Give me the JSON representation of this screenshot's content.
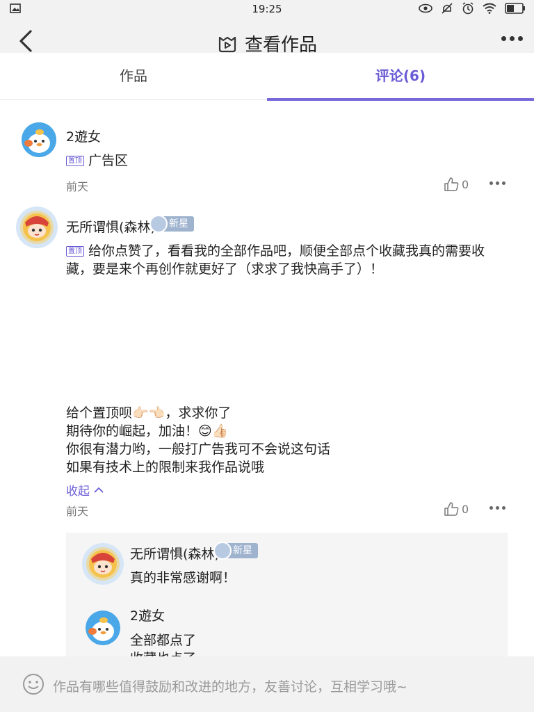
{
  "status_bar": {
    "time": "19:25"
  },
  "header": {
    "title": "查看作品"
  },
  "tabs": [
    {
      "label": "作品"
    },
    {
      "label": "评论(6)"
    }
  ],
  "comments": [
    {
      "user": "2遊女",
      "pinned_tag": "置顶",
      "text": "广告区",
      "time": "前天",
      "likes": "0"
    },
    {
      "user": "无所谓惧(森林)",
      "badge": "新星",
      "pinned_tag": "置顶",
      "text": "给你点赞了，看看我的全部作品吧，顺便全部点个收藏我真的需要收藏，要是来个再创作就更好了（求求了我快高手了）！",
      "lines": [
        "给个置顶呗👉🏻👈🏻，求求你了",
        "期待你的崛起，加油！😊👍🏻",
        "你很有潜力哟，一般打广告我可不会说这句话",
        "如果有技术上的限制来我作品说哦"
      ],
      "collapse": "收起",
      "time": "前天",
      "likes": "0"
    }
  ],
  "replies": [
    {
      "user": "无所谓惧(森林)",
      "badge": "新星",
      "text": "真的非常感谢啊！"
    },
    {
      "user": "2遊女",
      "text": "全部都点了",
      "text2": "收藏也点了"
    }
  ],
  "input": {
    "placeholder": "作品有哪些值得鼓励和改进的地方，友善讨论，互相学习哦~"
  }
}
